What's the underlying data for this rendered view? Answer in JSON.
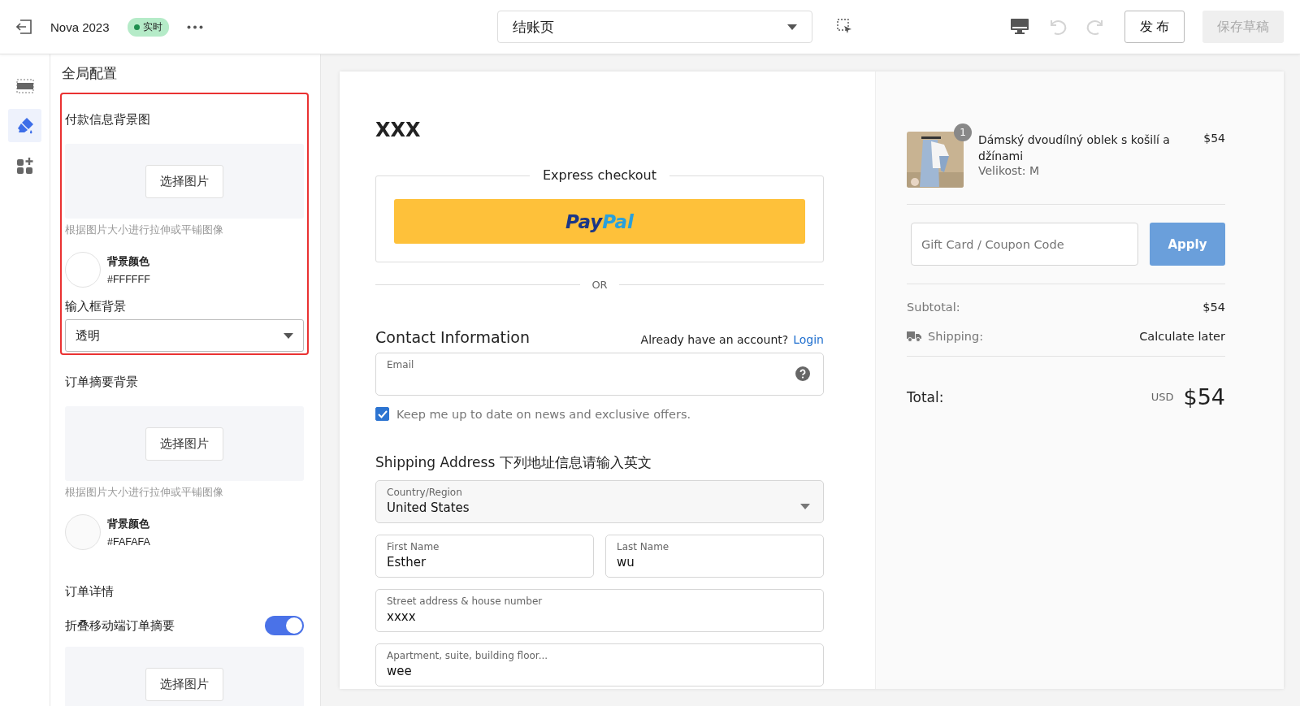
{
  "topbar": {
    "store": "Nova 2023",
    "status": {
      "label": "实时",
      "live": true
    },
    "page_select": {
      "value": "结账页"
    },
    "undo": {
      "disabled": true
    },
    "redo": {
      "disabled": true
    },
    "publish": "发 布",
    "save_draft": {
      "label": "保存草稿",
      "disabled": true
    }
  },
  "rail": [
    {
      "kind": "layout",
      "selected": false
    },
    {
      "kind": "brush",
      "selected": true
    },
    {
      "kind": "add",
      "selected": false
    }
  ],
  "settings": {
    "title": "全局配置",
    "sections": [
      {
        "highlighted": true,
        "items": [
          {
            "kind": "heading",
            "text": "付款信息背景图"
          },
          {
            "kind": "upload",
            "text": "选择图片"
          },
          {
            "kind": "hint",
            "text": "根据图片大小进行拉伸或平铺图像"
          },
          {
            "kind": "color",
            "text": "背景颜色",
            "value": "#FFFFFF",
            "color": "#ffffff"
          },
          {
            "kind": "label",
            "text": "输入框背景"
          },
          {
            "kind": "select",
            "text": "透明"
          }
        ]
      },
      {
        "highlighted": false,
        "items": [
          {
            "kind": "heading",
            "text": "订单摘要背景"
          },
          {
            "kind": "upload",
            "text": "选择图片"
          },
          {
            "kind": "hint",
            "text": "根据图片大小进行拉伸或平铺图像"
          },
          {
            "kind": "color",
            "text": "背景颜色",
            "value": "#FAFAFA",
            "color": "#fafafa"
          }
        ]
      },
      {
        "highlighted": false,
        "items": [
          {
            "kind": "heading",
            "text": "订单详情"
          },
          {
            "kind": "toggle",
            "text": "折叠移动端订单摘要",
            "on": true
          },
          {
            "kind": "upload",
            "text": "选择图片"
          }
        ]
      }
    ]
  },
  "checkout": {
    "store_name": "XXX",
    "express": {
      "title": "Express checkout",
      "paypal": [
        "Pay",
        "Pal"
      ]
    },
    "or": "OR",
    "contact": {
      "title": "Contact Information",
      "account_prompt": "Already have an account?",
      "login": "Login",
      "email_label": "Email",
      "newsletter": {
        "label": "Keep me up to date on news and exclusive offers.",
        "checked": true
      }
    },
    "shipping": {
      "title": "Shipping Address 下列地址信息请输入英文",
      "fields": [
        {
          "kind": "select",
          "label": "Country/Region",
          "value": "United States"
        },
        {
          "kind": "half",
          "label": "First Name",
          "value": "Esther"
        },
        {
          "kind": "half",
          "label": "Last Name",
          "value": "wu"
        },
        {
          "kind": "full",
          "label": "Street address & house number",
          "value": "xxxx"
        },
        {
          "kind": "full",
          "label": "Apartment, suite, building floor...",
          "value": "wee"
        }
      ]
    }
  },
  "summary": {
    "item": {
      "quantity": "1",
      "name": "Dámský dvoudílný oblek s košilí a džínami",
      "variant": "Velikost: M",
      "price": "$54"
    },
    "coupon": {
      "placeholder": "Gift Card / Coupon Code",
      "button": "Apply"
    },
    "subtotal": {
      "label": "Subtotal:",
      "value": "$54"
    },
    "shipping": {
      "label": "Shipping:",
      "value": "Calculate later"
    },
    "total": {
      "label": "Total:",
      "currency": "USD",
      "value": "$54"
    }
  }
}
